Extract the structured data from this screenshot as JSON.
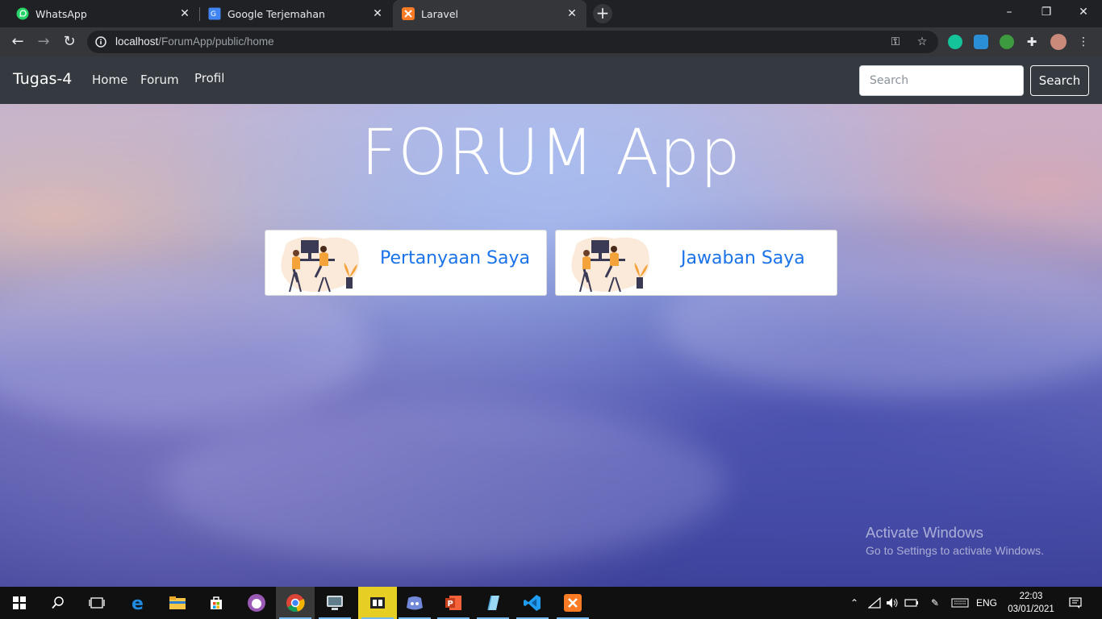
{
  "browser": {
    "tabs": [
      {
        "title": "WhatsApp",
        "icon": "whatsapp-icon",
        "active": false
      },
      {
        "title": "Google Terjemahan",
        "icon": "google-translate-icon",
        "active": false
      },
      {
        "title": "Laravel",
        "icon": "xampp-icon",
        "active": true
      }
    ],
    "address": {
      "host": "localhost",
      "path": "/ForumApp/public/home"
    }
  },
  "site": {
    "brand": "Tugas-4",
    "nav": [
      "Home",
      "Forum",
      "Profil"
    ],
    "search": {
      "placeholder": "Search",
      "button": "Search"
    },
    "title": "FORUM App",
    "cards": [
      {
        "label": "Pertanyaan Saya"
      },
      {
        "label": "Jawaban Saya"
      }
    ]
  },
  "watermark": {
    "line1": "Activate Windows",
    "line2": "Go to Settings to activate Windows."
  },
  "taskbar": {
    "lang": "ENG",
    "time": "22:03",
    "date": "03/01/2021",
    "apps": [
      "windows-start-icon",
      "search-icon",
      "task-view-icon",
      "edge-icon",
      "file-explorer-icon",
      "store-icon",
      "github-desktop-icon",
      "chrome-icon",
      "app-icon",
      "filmora-icon",
      "discord-icon",
      "powerpoint-icon",
      "notes-icon",
      "vscode-icon",
      "xampp-icon"
    ]
  },
  "colors": {
    "navbar": "#343a40",
    "link": "#1a73e8",
    "browser_dark": "#202124",
    "browser_tab": "#35363a"
  }
}
